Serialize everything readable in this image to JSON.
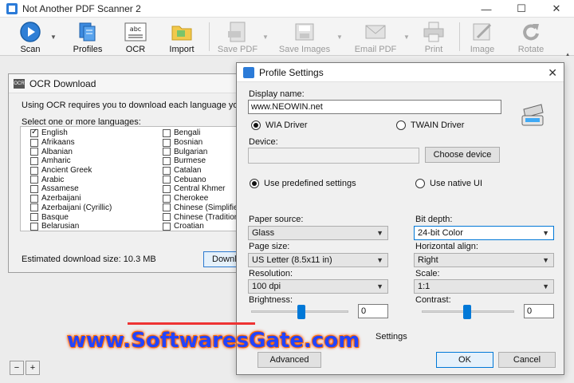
{
  "window": {
    "title": "Not Another PDF Scanner 2"
  },
  "toolbar": {
    "scan": "Scan",
    "profiles": "Profiles",
    "ocr": "OCR",
    "ocr_icon_text": "abc",
    "import": "Import",
    "save_pdf": "Save PDF",
    "save_images": "Save Images",
    "email_pdf": "Email PDF",
    "print": "Print",
    "image": "Image",
    "rotate": "Rotate"
  },
  "ocr_dialog": {
    "title": "OCR Download",
    "icon_text": "OCR",
    "info": "Using OCR requires you to download each language you wa",
    "select_label": "Select one or more languages:",
    "languages_col1": [
      "English",
      "Afrikaans",
      "Albanian",
      "Amharic",
      "Ancient Greek",
      "Arabic",
      "Assamese",
      "Azerbaijani",
      "Azerbaijani (Cyrillic)",
      "Basque",
      "Belarusian"
    ],
    "languages_col2": [
      "Bengali",
      "Bosnian",
      "Bulgarian",
      "Burmese",
      "Catalan",
      "Cebuano",
      "Central Khmer",
      "Cherokee",
      "Chinese (Simplified)",
      "Chinese (Traditional)",
      "Croatian"
    ],
    "download_size": "Estimated download size: 10.3 MB",
    "download_button": "Downl"
  },
  "profile_dialog": {
    "title": "Profile Settings",
    "display_name_label": "Display name:",
    "display_name_value": "www.NEOWIN.net",
    "wia_driver": "WIA Driver",
    "twain_driver": "TWAIN Driver",
    "device_label": "Device:",
    "choose_device": "Choose device",
    "use_predefined": "Use predefined settings",
    "use_native": "Use native UI",
    "paper_source_label": "Paper source:",
    "paper_source_value": "Glass",
    "bit_depth_label": "Bit depth:",
    "bit_depth_value": "24-bit Color",
    "page_size_label": "Page size:",
    "page_size_value": "US Letter (8.5x11 in)",
    "horizontal_align_label": "Horizontal align:",
    "horizontal_align_value": "Right",
    "resolution_label": "Resolution:",
    "resolution_value": "100 dpi",
    "scale_label": "Scale:",
    "scale_value": "1:1",
    "brightness_label": "Brightness:",
    "brightness_value": "0",
    "contrast_label": "Contrast:",
    "contrast_value": "0",
    "settings_partial": "Settings",
    "advanced_button": "Advanced",
    "ok_button": "OK",
    "cancel_button": "Cancel"
  },
  "watermark": "www.SoftwaresGate.com",
  "colors": {
    "accent": "#0078d7",
    "watermark": "#2244ff"
  }
}
